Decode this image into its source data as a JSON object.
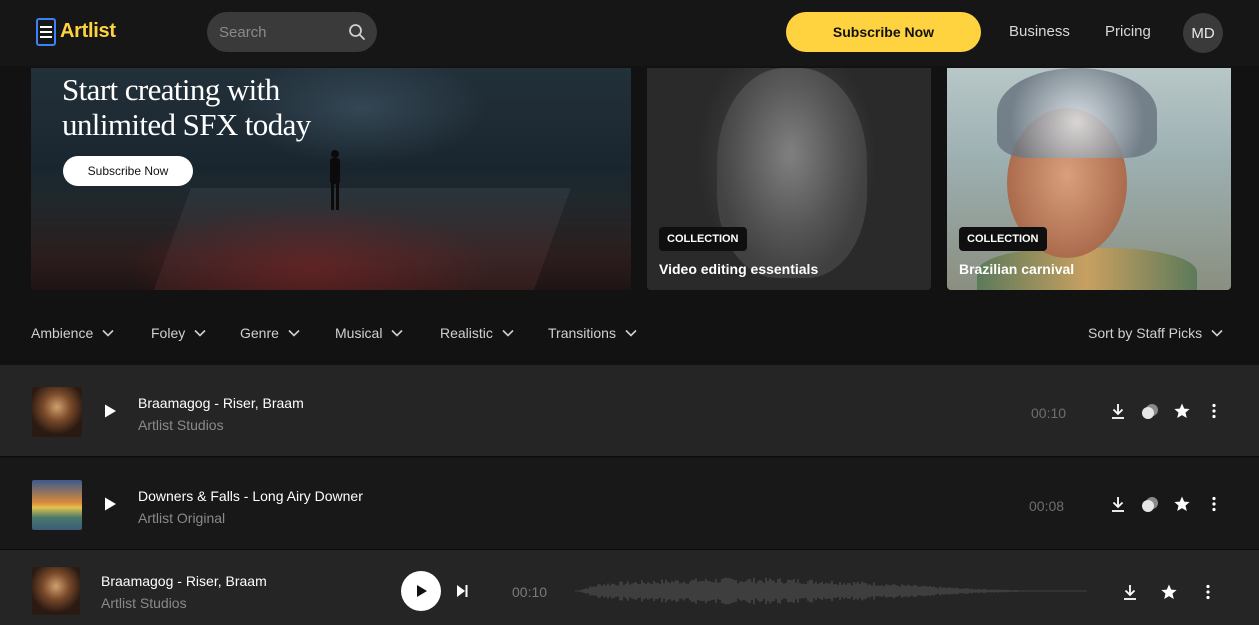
{
  "header": {
    "logo": "Artlist",
    "search_placeholder": "Search",
    "subscribe_label": "Subscribe Now",
    "nav": [
      "Business",
      "Pricing"
    ],
    "avatar_initials": "MD"
  },
  "hero": {
    "title": "Start creating with unlimited SFX today",
    "cta_label": "Subscribe Now"
  },
  "collections": [
    {
      "badge": "COLLECTION",
      "title": "Video editing essentials"
    },
    {
      "badge": "COLLECTION",
      "title": "Brazilian carnival"
    }
  ],
  "filters": [
    "Ambience",
    "Foley",
    "Genre",
    "Musical",
    "Realistic",
    "Transitions"
  ],
  "sort_label": "Sort by Staff Picks",
  "tracks": [
    {
      "title": "Braamagog - Riser, Braam",
      "artist": "Artlist Studios",
      "duration": "00:10"
    },
    {
      "title": "Downers & Falls - Long Airy Downer",
      "artist": "Artlist Original",
      "duration": "00:08"
    }
  ],
  "player": {
    "title": "Braamagog - Riser, Braam",
    "artist": "Artlist Studios",
    "time": "00:10"
  },
  "colors": {
    "accent": "#ffd23f",
    "background": "#121212",
    "row_active": "#252525"
  }
}
